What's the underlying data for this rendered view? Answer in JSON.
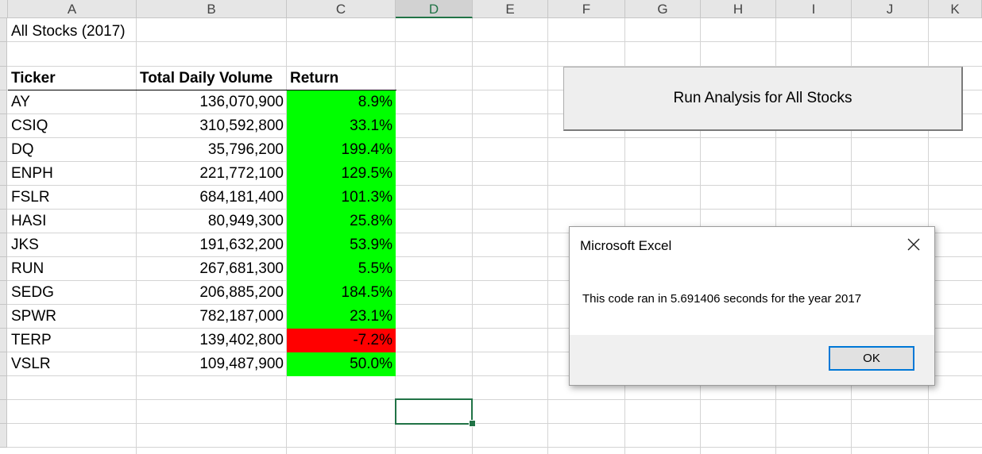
{
  "columns": [
    "A",
    "B",
    "C",
    "D",
    "E",
    "F",
    "G",
    "H",
    "I",
    "J",
    "K"
  ],
  "active_column": "D",
  "sheet": {
    "title": "All Stocks (2017)",
    "headers": {
      "ticker": "Ticker",
      "volume": "Total Daily Volume",
      "return": "Return"
    },
    "rows": [
      {
        "ticker": "AY",
        "volume": "136,070,900",
        "return": "8.9%",
        "positive": true
      },
      {
        "ticker": "CSIQ",
        "volume": "310,592,800",
        "return": "33.1%",
        "positive": true
      },
      {
        "ticker": "DQ",
        "volume": "35,796,200",
        "return": "199.4%",
        "positive": true
      },
      {
        "ticker": "ENPH",
        "volume": "221,772,100",
        "return": "129.5%",
        "positive": true
      },
      {
        "ticker": "FSLR",
        "volume": "684,181,400",
        "return": "101.3%",
        "positive": true
      },
      {
        "ticker": "HASI",
        "volume": "80,949,300",
        "return": "25.8%",
        "positive": true
      },
      {
        "ticker": "JKS",
        "volume": "191,632,200",
        "return": "53.9%",
        "positive": true
      },
      {
        "ticker": "RUN",
        "volume": "267,681,300",
        "return": "5.5%",
        "positive": true
      },
      {
        "ticker": "SEDG",
        "volume": "206,885,200",
        "return": "184.5%",
        "positive": true
      },
      {
        "ticker": "SPWR",
        "volume": "782,187,000",
        "return": "23.1%",
        "positive": true
      },
      {
        "ticker": "TERP",
        "volume": "139,402,800",
        "return": "-7.2%",
        "positive": false
      },
      {
        "ticker": "VSLR",
        "volume": "109,487,900",
        "return": "50.0%",
        "positive": true
      }
    ]
  },
  "run_button": {
    "label": "Run Analysis for All Stocks"
  },
  "dialog": {
    "title": "Microsoft Excel",
    "message": "This code ran in 5.691406 seconds for the year 2017",
    "ok_label": "OK"
  },
  "colors": {
    "positive": "#00ff00",
    "negative": "#ff0000",
    "accent": "#217346",
    "focus": "#0078d7"
  },
  "icons": {
    "close": "close-icon"
  }
}
